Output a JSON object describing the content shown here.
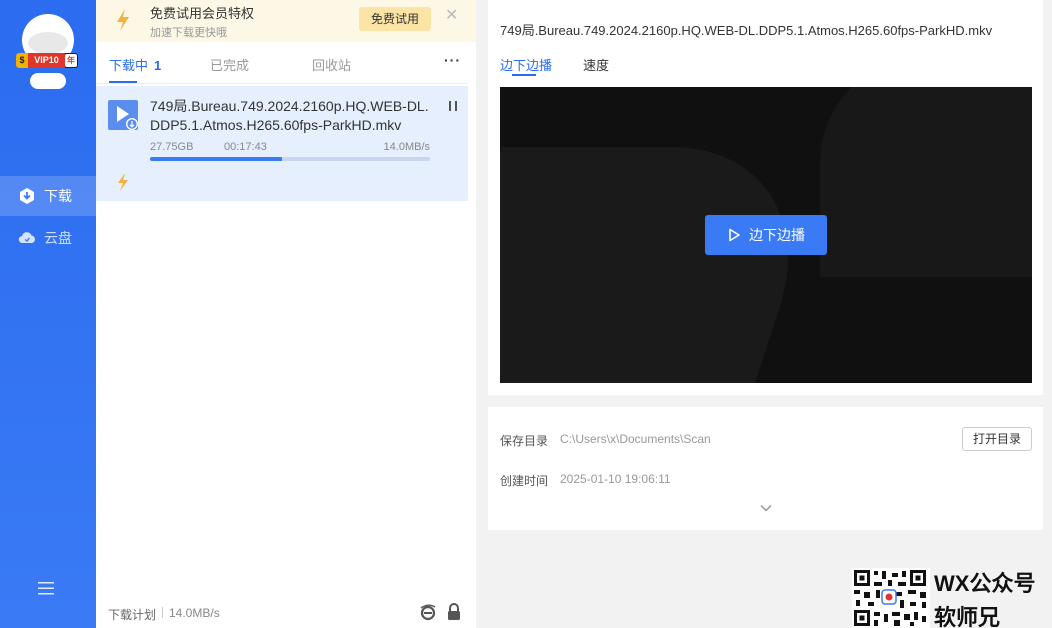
{
  "sidebar": {
    "vip_badge": {
      "s": "$",
      "label": "VIP10",
      "suffix": "年"
    },
    "nav": [
      {
        "label": "下载",
        "icon": "download-hex-icon",
        "active": true
      },
      {
        "label": "云盘",
        "icon": "cloud-icon",
        "active": false
      }
    ],
    "menu_icon": "hamburger-menu-icon"
  },
  "promo": {
    "title": "免费试用会员特权",
    "subtitle": "加速下载更快哦",
    "try_button": "免费试用",
    "close_icon": "close-icon"
  },
  "tabs": [
    {
      "label": "下载中",
      "count": "1",
      "active": true
    },
    {
      "label": "已完成",
      "active": false
    },
    {
      "label": "回收站",
      "active": false
    }
  ],
  "tabs_more": "···",
  "task": {
    "filename": "749局.Bureau.749.2024.2160p.HQ.WEB-DL.DDP5.1.Atmos.H265.60fps-ParkHD.mkv",
    "size": "27.75GB",
    "remaining": "00:17:43",
    "speed": "14.0MB/s",
    "progress": 0.47
  },
  "footer": {
    "plan": "下载计划",
    "speed": "14.0MB/s"
  },
  "detail": {
    "filename": "749局.Bureau.749.2024.2160p.HQ.WEB-DL.DDP5.1.Atmos.H265.60fps-ParkHD.mkv",
    "tabs": [
      {
        "label": "边下边播",
        "active": true
      },
      {
        "label": "速度",
        "active": false
      }
    ],
    "play_button": "边下边播"
  },
  "info": {
    "save_dir_label": "保存目录",
    "save_dir_value": "C:\\Users\\x\\Documents\\Scan",
    "open_dir_button": "打开目录",
    "created_label": "创建时间",
    "created_value": "2025-01-10 19:06:11"
  },
  "watermark": {
    "line1": "WX公众号",
    "line2": "软师兄"
  },
  "colors": {
    "accent": "#2b6cf0",
    "sidebar": "#3a7af5",
    "promo_bg": "#fdf7e6",
    "task_bg": "#e5effd",
    "bolt": "#f5b042"
  }
}
